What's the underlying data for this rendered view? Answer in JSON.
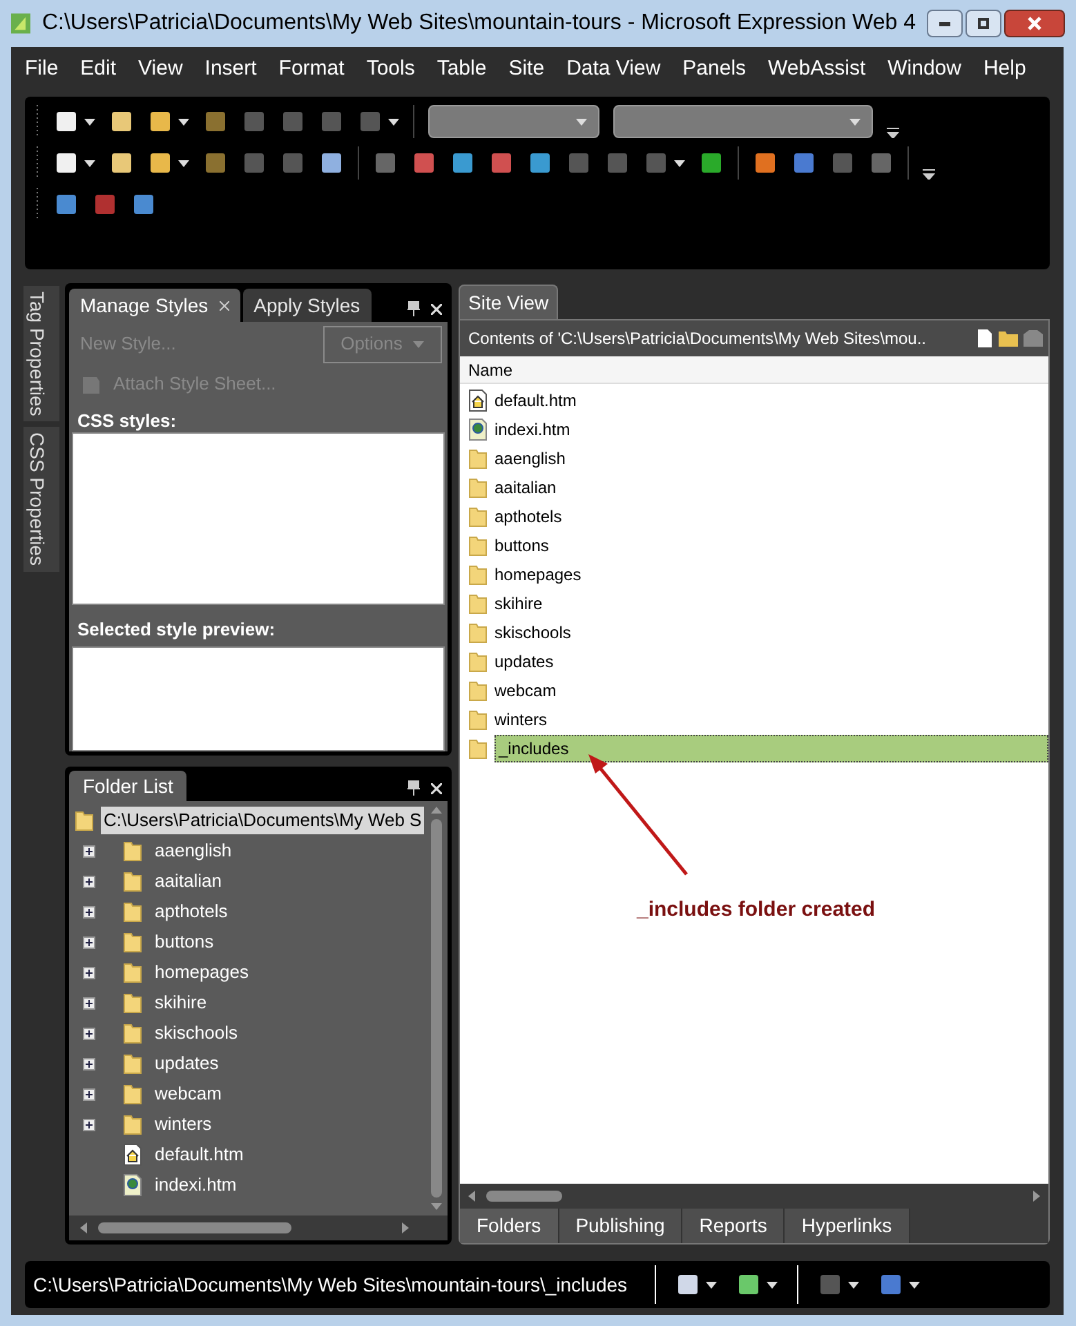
{
  "window": {
    "title": "C:\\Users\\Patricia\\Documents\\My Web Sites\\mountain-tours - Microsoft Expression Web 4"
  },
  "menu": [
    "File",
    "Edit",
    "View",
    "Insert",
    "Format",
    "Tools",
    "Table",
    "Site",
    "Data View",
    "Panels",
    "WebAssist",
    "Window",
    "Help"
  ],
  "side_tabs": [
    "Tag Properties",
    "CSS Properties"
  ],
  "styles_panel": {
    "tabs": [
      {
        "label": "Manage Styles",
        "selected": true
      },
      {
        "label": "Apply Styles",
        "selected": false
      }
    ],
    "new_style": "New Style...",
    "options": "Options",
    "attach": "Attach Style Sheet...",
    "css_label": "CSS styles:",
    "preview_label": "Selected style preview:"
  },
  "folder_list": {
    "title": "Folder List",
    "root": {
      "label": "C:\\Users\\Patricia\\Documents\\My Web S",
      "selected": true
    },
    "items": [
      {
        "kind": "folder",
        "label": "aaenglish"
      },
      {
        "kind": "folder",
        "label": "aaitalian"
      },
      {
        "kind": "folder",
        "label": "apthotels"
      },
      {
        "kind": "folder",
        "label": "buttons"
      },
      {
        "kind": "folder",
        "label": "homepages"
      },
      {
        "kind": "folder",
        "label": "skihire"
      },
      {
        "kind": "folder",
        "label": "skischools"
      },
      {
        "kind": "folder",
        "label": "updates"
      },
      {
        "kind": "folder",
        "label": "webcam"
      },
      {
        "kind": "folder",
        "label": "winters"
      },
      {
        "kind": "home",
        "label": "default.htm"
      },
      {
        "kind": "page",
        "label": "indexi.htm"
      }
    ]
  },
  "site_view": {
    "tab": "Site View",
    "path": "Contents of 'C:\\Users\\Patricia\\Documents\\My Web Sites\\mou..",
    "column": "Name",
    "rows": [
      {
        "kind": "home",
        "label": "default.htm",
        "selected": false
      },
      {
        "kind": "page",
        "label": "indexi.htm",
        "selected": false
      },
      {
        "kind": "folder",
        "label": "aaenglish",
        "selected": false
      },
      {
        "kind": "folder",
        "label": "aaitalian",
        "selected": false
      },
      {
        "kind": "folder",
        "label": "apthotels",
        "selected": false
      },
      {
        "kind": "folder",
        "label": "buttons",
        "selected": false
      },
      {
        "kind": "folder",
        "label": "homepages",
        "selected": false
      },
      {
        "kind": "folder",
        "label": "skihire",
        "selected": false
      },
      {
        "kind": "folder",
        "label": "skischools",
        "selected": false
      },
      {
        "kind": "folder",
        "label": "updates",
        "selected": false
      },
      {
        "kind": "folder",
        "label": "webcam",
        "selected": false
      },
      {
        "kind": "folder",
        "label": "winters",
        "selected": false
      },
      {
        "kind": "folder",
        "label": "_includes",
        "selected": true
      }
    ],
    "bottom_tabs": [
      {
        "label": "Folders",
        "selected": true
      },
      {
        "label": "Publishing",
        "selected": false
      },
      {
        "label": "Reports",
        "selected": false
      },
      {
        "label": "Hyperlinks",
        "selected": false
      }
    ],
    "annotation": "_includes folder created"
  },
  "status_bar": {
    "path": "C:\\Users\\Patricia\\Documents\\My Web Sites\\mountain-tours\\_includes"
  }
}
